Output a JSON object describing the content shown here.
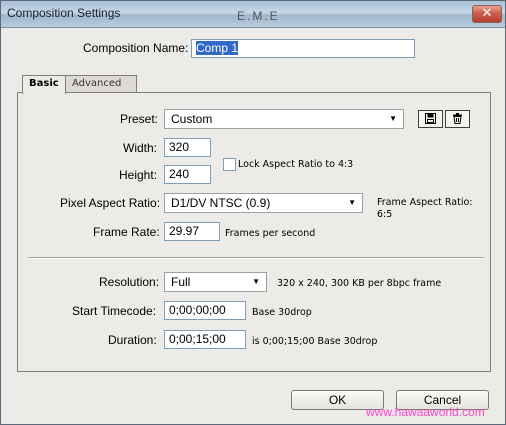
{
  "window": {
    "title": "Composition Settings",
    "watermark_top": "E.M.E",
    "close_glyph": "✕"
  },
  "composition_name": {
    "label": "Composition Name:",
    "value": "Comp 1"
  },
  "tabs": [
    {
      "label": "Basic",
      "active": true
    },
    {
      "label": "Advanced",
      "active": false
    }
  ],
  "preset": {
    "label": "Preset:",
    "value": "Custom",
    "save_icon": "save-icon",
    "delete_icon": "trash-icon"
  },
  "width": {
    "label": "Width:",
    "value": "320"
  },
  "height": {
    "label": "Height:",
    "value": "240"
  },
  "lock_aspect": {
    "label": "Lock Aspect Ratio to 4:3",
    "checked": false
  },
  "pixel_aspect": {
    "label": "Pixel Aspect Ratio:",
    "value": "D1/DV NTSC (0.9)"
  },
  "frame_aspect": {
    "line1": "Frame Aspect Ratio:",
    "line2": "6:5"
  },
  "frame_rate": {
    "label": "Frame Rate:",
    "value": "29.97",
    "unit": "Frames per second"
  },
  "resolution": {
    "label": "Resolution:",
    "value": "Full",
    "info": "320 x 240, 300 KB per 8bpc frame"
  },
  "start_timecode": {
    "label": "Start Timecode:",
    "value": "0;00;00;00",
    "note": "Base 30drop"
  },
  "duration": {
    "label": "Duration:",
    "value": "0;00;15;00",
    "note": "is 0;00;15;00  Base 30drop"
  },
  "buttons": {
    "ok": "OK",
    "cancel": "Cancel"
  },
  "watermark_bottom": "www.hawaaworld.com"
}
